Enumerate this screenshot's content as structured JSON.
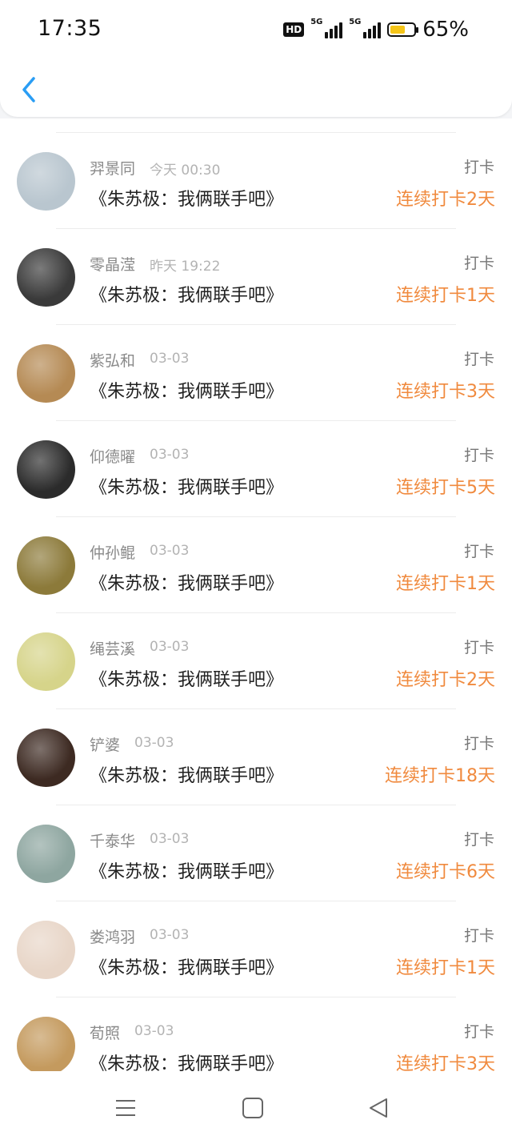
{
  "status_bar": {
    "time": "17:35",
    "hd_label": "HD",
    "signal1_label": "5G",
    "signal2_label": "5G",
    "battery_percent": 65,
    "battery_text": "65%"
  },
  "colors": {
    "accent": "#f08a3e",
    "back_arrow": "#2a9df4"
  },
  "entries": [
    {
      "name": "羿景同",
      "date": "今天 00:30",
      "book": "《朱苏极：我俩联手吧》",
      "tag": "打卡",
      "streak": "连续打卡2天",
      "avatar_color": "#b9c6cf"
    },
    {
      "name": "零晶滢",
      "date": "昨天 19:22",
      "book": "《朱苏极：我俩联手吧》",
      "tag": "打卡",
      "streak": "连续打卡1天",
      "avatar_color": "#3a3a3a"
    },
    {
      "name": "紫弘和",
      "date": "03-03",
      "book": "《朱苏极：我俩联手吧》",
      "tag": "打卡",
      "streak": "连续打卡3天",
      "avatar_color": "#b58a54"
    },
    {
      "name": "仰德曜",
      "date": "03-03",
      "book": "《朱苏极：我俩联手吧》",
      "tag": "打卡",
      "streak": "连续打卡5天",
      "avatar_color": "#2b2b2b"
    },
    {
      "name": "仲孙鲲",
      "date": "03-03",
      "book": "《朱苏极：我俩联手吧》",
      "tag": "打卡",
      "streak": "连续打卡1天",
      "avatar_color": "#8c7a3a"
    },
    {
      "name": "绳芸溪",
      "date": "03-03",
      "book": "《朱苏极：我俩联手吧》",
      "tag": "打卡",
      "streak": "连续打卡2天",
      "avatar_color": "#d6d48a"
    },
    {
      "name": "铲婆",
      "date": "03-03",
      "book": "《朱苏极：我俩联手吧》",
      "tag": "打卡",
      "streak": "连续打卡18天",
      "avatar_color": "#3d2a22"
    },
    {
      "name": "千泰华",
      "date": "03-03",
      "book": "《朱苏极：我俩联手吧》",
      "tag": "打卡",
      "streak": "连续打卡6天",
      "avatar_color": "#8ea6a0"
    },
    {
      "name": "娄鸿羽",
      "date": "03-03",
      "book": "《朱苏极：我俩联手吧》",
      "tag": "打卡",
      "streak": "连续打卡1天",
      "avatar_color": "#e8d6c8"
    },
    {
      "name": "荀照",
      "date": "03-03",
      "book": "《朱苏极：我俩联手吧》",
      "tag": "打卡",
      "streak": "连续打卡3天",
      "avatar_color": "#c49a5e"
    }
  ]
}
